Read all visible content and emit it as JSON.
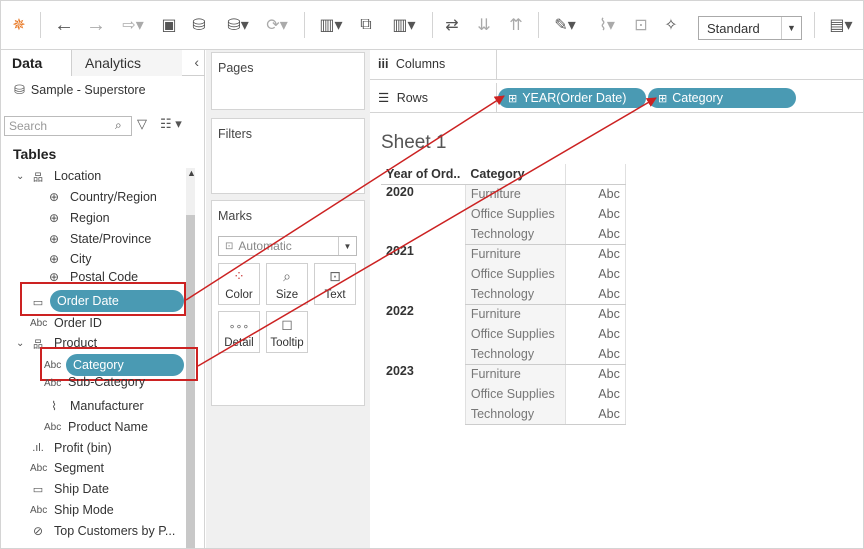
{
  "toolbar": {
    "marks_size": "Standard"
  },
  "left_pane": {
    "tabs": [
      "Data",
      "Analytics"
    ],
    "datasource": "Sample - Superstore",
    "search_placeholder": "Search",
    "tables_heading": "Tables",
    "groups": {
      "location": "Location",
      "product": "Product"
    },
    "fields": {
      "country": "Country/Region",
      "region": "Region",
      "state": "State/Province",
      "city": "City",
      "postal": "Postal Code",
      "order_date": "Order Date",
      "order_id": "Order ID",
      "category": "Category",
      "subcategory": "Sub-Category",
      "manufacturer": "Manufacturer",
      "product_name": "Product Name",
      "profit_bin": "Profit (bin)",
      "segment": "Segment",
      "ship_date": "Ship Date",
      "ship_mode": "Ship Mode",
      "top_customers": "Top Customers by P..."
    },
    "type_label_abc": "Abc"
  },
  "cards": {
    "pages": "Pages",
    "filters": "Filters",
    "marks": "Marks",
    "mark_type": "Automatic",
    "buttons": [
      "Color",
      "Size",
      "Text",
      "Detail",
      "Tooltip"
    ]
  },
  "shelves": {
    "columns_label": "Columns",
    "rows_label": "Rows",
    "row_pills": [
      "YEAR(Order Date)",
      "Category"
    ]
  },
  "sheet": {
    "title": "Sheet 1",
    "headers": [
      "Year of Ord..",
      "Category"
    ],
    "years": [
      "2020",
      "2021",
      "2022",
      "2023"
    ],
    "categories": [
      "Furniture",
      "Office Supplies",
      "Technology"
    ],
    "cell": "Abc"
  }
}
